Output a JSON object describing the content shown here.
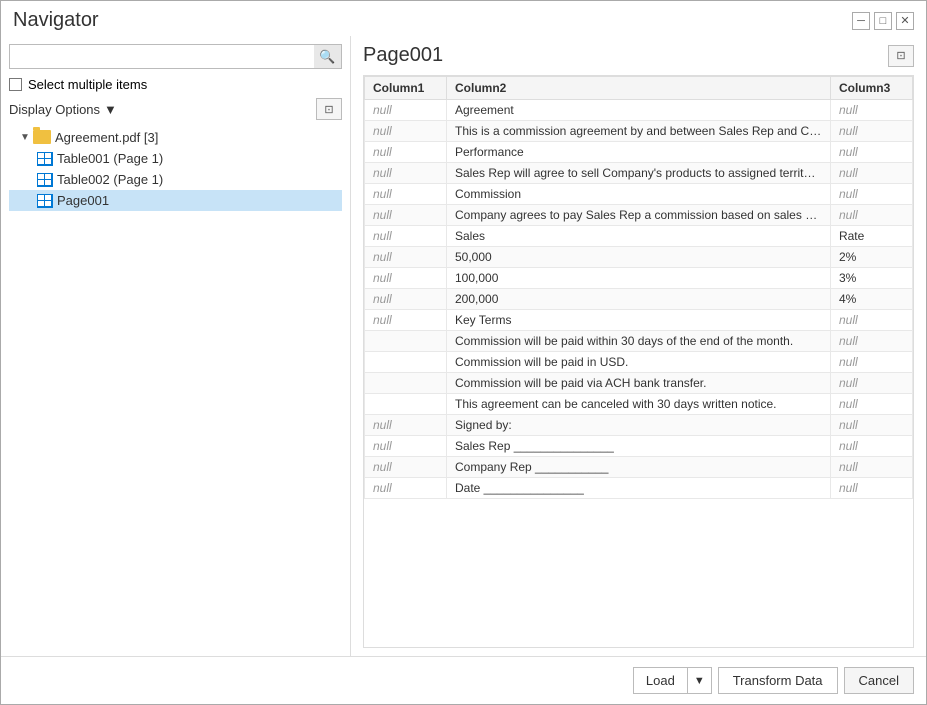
{
  "dialog": {
    "title": "Navigator"
  },
  "titlebar": {
    "minimize_label": "─",
    "maximize_label": "□",
    "close_label": "✕"
  },
  "left_panel": {
    "search_placeholder": "",
    "search_icon": "🔍",
    "select_multiple_label": "Select multiple items",
    "display_options_label": "Display Options",
    "display_options_arrow": "▼",
    "preview_icon": "⊡",
    "tree": {
      "root": {
        "label": "Agreement.pdf [3]",
        "children": [
          {
            "label": "Table001 (Page 1)"
          },
          {
            "label": "Table002 (Page 1)"
          },
          {
            "label": "Page001",
            "selected": true
          }
        ]
      }
    }
  },
  "right_panel": {
    "title": "Page001",
    "preview_icon": "⊡",
    "table": {
      "columns": [
        "Column1",
        "Column2",
        "Column3"
      ],
      "rows": [
        [
          "null",
          "Agreement",
          "null"
        ],
        [
          "null",
          "This is a commission agreement by and between Sales Rep and Company.",
          "null"
        ],
        [
          "null",
          "Performance",
          "null"
        ],
        [
          "null",
          "Sales Rep will agree to sell Company's products to assigned territory in a p",
          "null"
        ],
        [
          "null",
          "Commission",
          "null"
        ],
        [
          "null",
          "Company agrees to pay Sales Rep a commission based on sales according",
          "null"
        ],
        [
          "null",
          "Sales",
          "Rate"
        ],
        [
          "null",
          "50,000",
          "2%"
        ],
        [
          "null",
          "100,000",
          "3%"
        ],
        [
          "null",
          "200,000",
          "4%"
        ],
        [
          "null",
          "Key Terms",
          "null"
        ],
        [
          "",
          "Commission will be paid within 30 days of the end of the month.",
          "null"
        ],
        [
          "",
          "Commission will be paid in USD.",
          "null"
        ],
        [
          "",
          "Commission will be paid via ACH bank transfer.",
          "null"
        ],
        [
          "",
          "This agreement can be canceled with 30 days written notice.",
          "null"
        ],
        [
          "null",
          "Signed by:",
          "null"
        ],
        [
          "null",
          "Sales Rep _______________",
          "null"
        ],
        [
          "null",
          "Company Rep ___________",
          "null"
        ],
        [
          "null",
          "Date _______________",
          "null"
        ]
      ]
    }
  },
  "footer": {
    "load_label": "Load",
    "load_dropdown_label": "▼",
    "transform_label": "Transform Data",
    "cancel_label": "Cancel"
  }
}
